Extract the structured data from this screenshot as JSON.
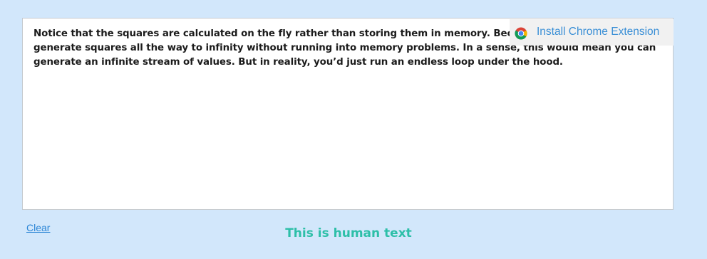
{
  "editor": {
    "text": "Notice that the squares are calculated on the fly rather than storing them in memory. Because of this, you could generate squares all the way to infinity without running into memory problems. In a sense, this would mean you can generate an infinite stream of values. But in reality, you’d just run an endless loop under the hood."
  },
  "extension_banner": {
    "label": "Install Chrome Extension",
    "icon": "chrome-icon"
  },
  "actions": {
    "clear_label": "Clear"
  },
  "result": {
    "label": "This is human text",
    "color": "#2dbfa8"
  },
  "colors": {
    "background": "#d2e7fb",
    "link": "#2c86d6",
    "extension_text": "#3a8fd6"
  }
}
